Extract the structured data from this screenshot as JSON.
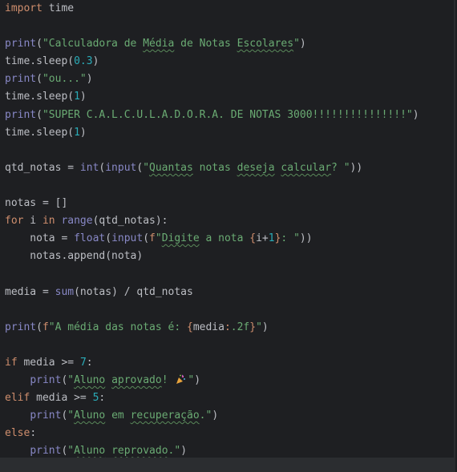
{
  "editor": {
    "lines": [
      [
        {
          "t": "kw",
          "v": "import"
        },
        {
          "t": "plain",
          "v": " time"
        }
      ],
      [],
      [
        {
          "t": "bi",
          "v": "print"
        },
        {
          "t": "plain",
          "v": "("
        },
        {
          "t": "str",
          "v": "\"Calculadora de "
        },
        {
          "t": "str",
          "v": "Média",
          "typo": true
        },
        {
          "t": "str",
          "v": " de Notas "
        },
        {
          "t": "str",
          "v": "Escolares",
          "typo": true
        },
        {
          "t": "str",
          "v": "\""
        },
        {
          "t": "plain",
          "v": ")"
        }
      ],
      [
        {
          "t": "plain",
          "v": "time.sleep("
        },
        {
          "t": "num",
          "v": "0.3"
        },
        {
          "t": "plain",
          "v": ")"
        }
      ],
      [
        {
          "t": "bi",
          "v": "print"
        },
        {
          "t": "plain",
          "v": "("
        },
        {
          "t": "str",
          "v": "\"ou...\""
        },
        {
          "t": "plain",
          "v": ")"
        }
      ],
      [
        {
          "t": "plain",
          "v": "time.sleep("
        },
        {
          "t": "num",
          "v": "1"
        },
        {
          "t": "plain",
          "v": ")"
        }
      ],
      [
        {
          "t": "bi",
          "v": "print"
        },
        {
          "t": "plain",
          "v": "("
        },
        {
          "t": "str",
          "v": "\"SUPER C.A.L.C.U.L.A.D.O.R.A. DE NOTAS 3000!!!!!!!!!!!!!!!\""
        },
        {
          "t": "plain",
          "v": ")"
        }
      ],
      [
        {
          "t": "plain",
          "v": "time.sleep("
        },
        {
          "t": "num",
          "v": "1"
        },
        {
          "t": "plain",
          "v": ")"
        }
      ],
      [],
      [
        {
          "t": "plain",
          "v": "qtd_notas = "
        },
        {
          "t": "bi",
          "v": "int"
        },
        {
          "t": "plain",
          "v": "("
        },
        {
          "t": "bi",
          "v": "input"
        },
        {
          "t": "plain",
          "v": "("
        },
        {
          "t": "str",
          "v": "\""
        },
        {
          "t": "str",
          "v": "Quantas",
          "typo": true
        },
        {
          "t": "str",
          "v": " notas "
        },
        {
          "t": "str",
          "v": "deseja",
          "typo": true
        },
        {
          "t": "str",
          "v": " "
        },
        {
          "t": "str",
          "v": "calcular",
          "typo": true
        },
        {
          "t": "str",
          "v": "? \""
        },
        {
          "t": "plain",
          "v": "))"
        }
      ],
      [],
      [
        {
          "t": "plain",
          "v": "notas = []"
        }
      ],
      [
        {
          "t": "kw",
          "v": "for"
        },
        {
          "t": "plain",
          "v": " i "
        },
        {
          "t": "kw",
          "v": "in"
        },
        {
          "t": "plain",
          "v": " "
        },
        {
          "t": "bi",
          "v": "range"
        },
        {
          "t": "plain",
          "v": "(qtd_notas):"
        }
      ],
      [
        {
          "t": "plain",
          "v": "    nota = "
        },
        {
          "t": "bi",
          "v": "float"
        },
        {
          "t": "plain",
          "v": "("
        },
        {
          "t": "bi",
          "v": "input"
        },
        {
          "t": "plain",
          "v": "("
        },
        {
          "t": "fsb",
          "v": "f"
        },
        {
          "t": "str",
          "v": "\""
        },
        {
          "t": "str",
          "v": "Digite",
          "typo": true
        },
        {
          "t": "str",
          "v": " a nota "
        },
        {
          "t": "fsb",
          "v": "{"
        },
        {
          "t": "plain",
          "v": "i+"
        },
        {
          "t": "num",
          "v": "1"
        },
        {
          "t": "fsb",
          "v": "}"
        },
        {
          "t": "str",
          "v": ": \""
        },
        {
          "t": "plain",
          "v": "))"
        }
      ],
      [
        {
          "t": "plain",
          "v": "    notas.append(nota)"
        }
      ],
      [],
      [
        {
          "t": "plain",
          "v": "media = "
        },
        {
          "t": "bi",
          "v": "sum"
        },
        {
          "t": "plain",
          "v": "(notas) / qtd_notas"
        }
      ],
      [],
      [
        {
          "t": "bi",
          "v": "print"
        },
        {
          "t": "plain",
          "v": "("
        },
        {
          "t": "fsb",
          "v": "f"
        },
        {
          "t": "str",
          "v": "\"A média das notas é: "
        },
        {
          "t": "fsb",
          "v": "{"
        },
        {
          "t": "plain",
          "v": "media"
        },
        {
          "t": "fsb",
          "v": ":"
        },
        {
          "t": "str",
          "v": ".2f"
        },
        {
          "t": "fsb",
          "v": "}"
        },
        {
          "t": "str",
          "v": "\""
        },
        {
          "t": "plain",
          "v": ")"
        }
      ],
      [],
      [
        {
          "t": "kw",
          "v": "if"
        },
        {
          "t": "plain",
          "v": " media >= "
        },
        {
          "t": "num",
          "v": "7"
        },
        {
          "t": "plain",
          "v": ":"
        }
      ],
      [
        {
          "t": "plain",
          "v": "    "
        },
        {
          "t": "bi",
          "v": "print"
        },
        {
          "t": "plain",
          "v": "("
        },
        {
          "t": "str",
          "v": "\""
        },
        {
          "t": "str",
          "v": "Aluno",
          "typo": true
        },
        {
          "t": "str",
          "v": " "
        },
        {
          "t": "str",
          "v": "aprovado",
          "typo": true
        },
        {
          "t": "str",
          "v": "! "
        },
        {
          "t": "emoji",
          "v": "party-popper"
        },
        {
          "t": "str",
          "v": "\""
        },
        {
          "t": "plain",
          "v": ")"
        }
      ],
      [
        {
          "t": "kw",
          "v": "elif"
        },
        {
          "t": "plain",
          "v": " media >= "
        },
        {
          "t": "num",
          "v": "5"
        },
        {
          "t": "plain",
          "v": ":"
        }
      ],
      [
        {
          "t": "plain",
          "v": "    "
        },
        {
          "t": "bi",
          "v": "print"
        },
        {
          "t": "plain",
          "v": "("
        },
        {
          "t": "str",
          "v": "\""
        },
        {
          "t": "str",
          "v": "Aluno",
          "typo": true
        },
        {
          "t": "str",
          "v": " em "
        },
        {
          "t": "str",
          "v": "recuperação",
          "typo": true
        },
        {
          "t": "str",
          "v": ".\""
        },
        {
          "t": "plain",
          "v": ")"
        }
      ],
      [
        {
          "t": "kw",
          "v": "else"
        },
        {
          "t": "plain",
          "v": ":"
        }
      ],
      [
        {
          "t": "plain",
          "v": "    "
        },
        {
          "t": "bi",
          "v": "print"
        },
        {
          "t": "plain",
          "v": "("
        },
        {
          "t": "str",
          "v": "\""
        },
        {
          "t": "str",
          "v": "Aluno",
          "typo": true
        },
        {
          "t": "str",
          "v": " "
        },
        {
          "t": "str",
          "v": "reprovado",
          "typo": true
        },
        {
          "t": "str",
          "v": ".\""
        },
        {
          "t": "plain",
          "v": ")"
        }
      ]
    ]
  },
  "colors": {
    "background": "#1e1f22",
    "keyword": "#cf8e6d",
    "builtin": "#8888c6",
    "string": "#6aab73",
    "number": "#2aacb8",
    "text": "#bcbec4"
  }
}
